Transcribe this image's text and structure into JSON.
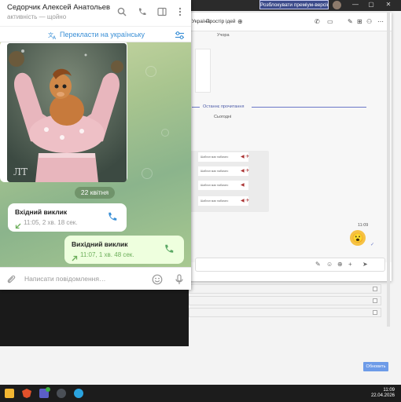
{
  "browser": {
    "premium_label": "Розблокувати преміум-версію",
    "win_controls": [
      "—",
      "▢",
      "✕"
    ]
  },
  "teams": {
    "tab_ukraine": "Україна",
    "tab_ideas": "Простір ідей",
    "yesterday_label": "Учора",
    "last_read_label": "Останнє прочитання",
    "today_label": "Сьогодні",
    "msg_rows": [
      "Шаблон має набагато",
      "Шаблон має набагато",
      "Шаблон має набагато",
      "Шаблон має набагато"
    ],
    "time": "11:09",
    "update_button": "Обновить"
  },
  "telegram": {
    "contact_name": "Седорчик Алексей Анатольев…",
    "status": "активність — щойно",
    "translate_label": "Перекласти на українську",
    "date_pill": "22 квітня",
    "incoming_call": {
      "title": "Вхідний виклик",
      "details": "11:05, 2 хв. 18 сек."
    },
    "outgoing_call": {
      "title": "Вихідний виклик",
      "details": "11:07, 1 хв. 48 сек."
    },
    "input_placeholder": "Написати повідомлення…",
    "colors": {
      "accent": "#3a8fd6",
      "outgoing_bubble": "#eeffde",
      "incoming_call_icon": "#6cae5a"
    }
  },
  "taskbar": {
    "time": "11:09",
    "date": "22.04.2026",
    "apps": [
      "folder-icon",
      "brave-icon",
      "teams-icon",
      "settings-icon",
      "telegram-icon"
    ]
  }
}
